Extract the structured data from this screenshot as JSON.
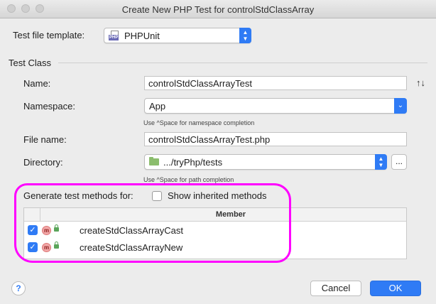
{
  "window": {
    "title": "Create New PHP Test for controlStdClassArray"
  },
  "template": {
    "label": "Test file template:",
    "value": "PHPUnit",
    "icon": "phpunit-icon"
  },
  "test_class": {
    "section_label": "Test Class",
    "name": {
      "label": "Name:",
      "value": "controlStdClassArrayTest"
    },
    "namespace": {
      "label": "Namespace:",
      "value": "App",
      "hint": "Use ^Space for namespace completion"
    },
    "file_name": {
      "label": "File name:",
      "value": "controlStdClassArrayTest.php"
    },
    "directory": {
      "label": "Directory:",
      "value": ".../tryPhp/tests",
      "hint": "Use ^Space for path completion",
      "browse_label": "..."
    }
  },
  "methods": {
    "generate_label": "Generate test methods for:",
    "show_inherited_label": "Show inherited methods",
    "show_inherited_checked": false,
    "column_header": "Member",
    "rows": [
      {
        "checked": true,
        "kind": "m",
        "name": "createStdClassArrayCast"
      },
      {
        "checked": true,
        "kind": "m",
        "name": "createStdClassArrayNew"
      }
    ]
  },
  "buttons": {
    "help": "?",
    "cancel": "Cancel",
    "ok": "OK"
  },
  "colors": {
    "accent": "#2f7bf5",
    "highlight": "#ff00ff"
  }
}
